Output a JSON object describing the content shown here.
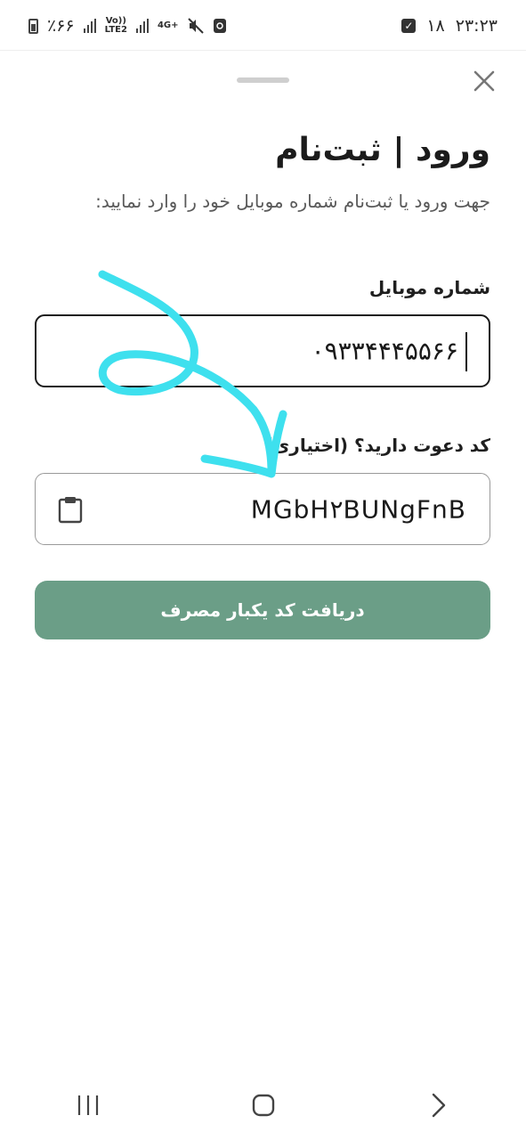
{
  "status_bar": {
    "time": "۲۳:۲۳",
    "date": "۱۸",
    "battery": "٪۶۶",
    "network_volte": "Vo))",
    "network_lte": "LTE2",
    "network_4g": "4G+"
  },
  "sheet": {
    "title": "ورود | ثبت‌نام",
    "subtitle": "جهت ورود یا ثبت‌نام شماره موبایل خود را وارد نمایید:"
  },
  "mobile_field": {
    "label": "شماره موبایل",
    "value": "۰۹۳۳۴۴۴۵۵۶۶"
  },
  "invite_field": {
    "label": "کد دعوت دارید؟ (اختیاری)",
    "value": "MGbH۲BUNgFnB"
  },
  "submit": {
    "label": "دریافت کد یکبار مصرف"
  },
  "colors": {
    "accent": "#6b9e87",
    "annotation": "#3ee0ee"
  }
}
